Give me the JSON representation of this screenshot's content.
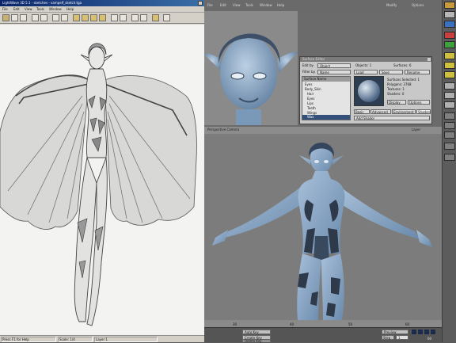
{
  "viewer": {
    "title": "LightWave 3D 5.1 - sketches - vampelf_sketch.tga",
    "menu": [
      "File",
      "Edit",
      "View",
      "Tools",
      "Window",
      "Help"
    ],
    "status": [
      "Press F1 for Help",
      "Scale: 1/4",
      "Layer 1"
    ]
  },
  "layout": {
    "top_tabs": [
      "File",
      "Edit",
      "View",
      "Tools",
      "Window",
      "Help",
      "Modify",
      "Options"
    ],
    "right_labels": [
      "Item",
      "Scene",
      "Display",
      "Render",
      "Settings"
    ]
  },
  "surface_editor": {
    "title": "Surface Editor",
    "edit_by_label": "Edit by",
    "edit_by_value": "Object",
    "filter_label": "Filter by",
    "filter_value": "Name",
    "list_header": "Surface Name",
    "surfaces": [
      "Eyes",
      "Body_Skin",
      "Hair",
      "Eyes",
      "Lips",
      "Teeth",
      "Wings",
      "Wax"
    ],
    "selected": "Wax",
    "display_label": "Objects: 1",
    "surfaces_count": "Surfaces: 6",
    "load": "Load",
    "save": "Save",
    "rename": "Rename",
    "info": [
      "Surfaces Selected: 1",
      "Polygons: 3768",
      "Textures: 1",
      "Shaders: 0"
    ],
    "tabs": [
      "Basic",
      "Advanced",
      "Environment",
      "Shaders"
    ],
    "display_btn": "Display",
    "options_btn": "Options",
    "shader_row": "Add Shader"
  },
  "viewport": {
    "bar_text": "Perspective Camera",
    "right_label": "Layer"
  },
  "timeline": {
    "ticks": [
      "30",
      "40",
      "50",
      "60"
    ],
    "auto_key": "Auto Key",
    "create_key": "Create Key",
    "delete_key": "Delete Key",
    "preview": "Preview",
    "step": "Step",
    "frame": "1",
    "frame_end": "60"
  },
  "colors": {
    "accent": "#0a246a",
    "render_skin": "#8aa8c8",
    "sketch_bg": "#f3f3f1"
  }
}
